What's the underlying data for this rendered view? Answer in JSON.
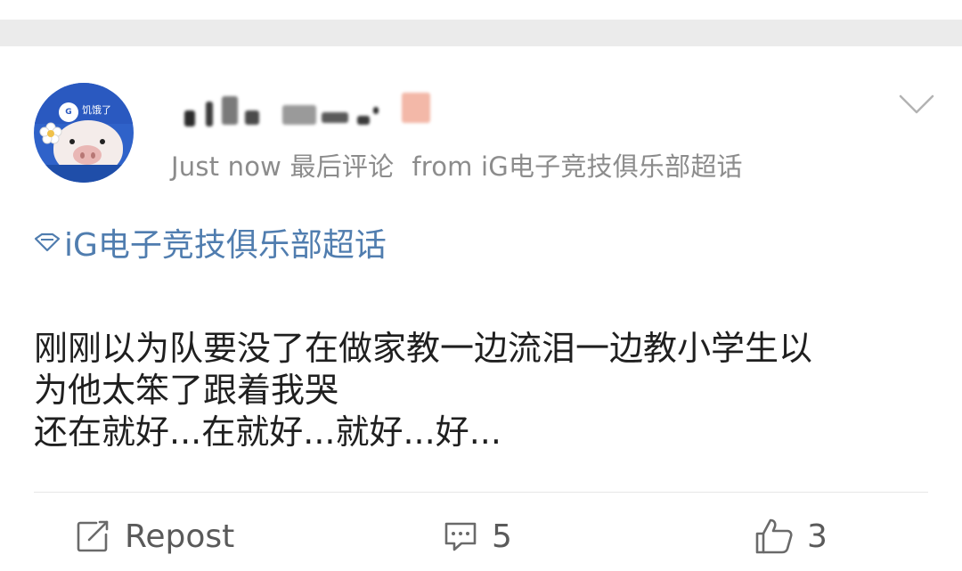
{
  "post": {
    "timestamp": "Just now",
    "last_comment_label": "最后评论",
    "source": "from iG电子竞技俱乐部超话",
    "supertopic": "iG电子竞技俱乐部超话",
    "text_lines": [
      "刚刚以为队要没了在做家教一边流泪一边教小学生以",
      "为他太笨了跟着我哭",
      "还在就好...在就好...就好...好..."
    ]
  },
  "avatar": {
    "cap_text": "饥饿了",
    "cap_badge": "G"
  },
  "actions": {
    "repost_label": "Repost",
    "comment_count": "5",
    "like_count": "3"
  },
  "icons": {
    "menu": "chevron-down-icon",
    "supertopic": "diamond-icon",
    "repost": "edit-square-icon",
    "comment": "comment-bubble-icon",
    "like": "thumbs-up-icon"
  },
  "colors": {
    "link": "#507daf",
    "meta": "#8c8c8c",
    "text": "#1f1f1f",
    "band": "#ebebeb"
  }
}
